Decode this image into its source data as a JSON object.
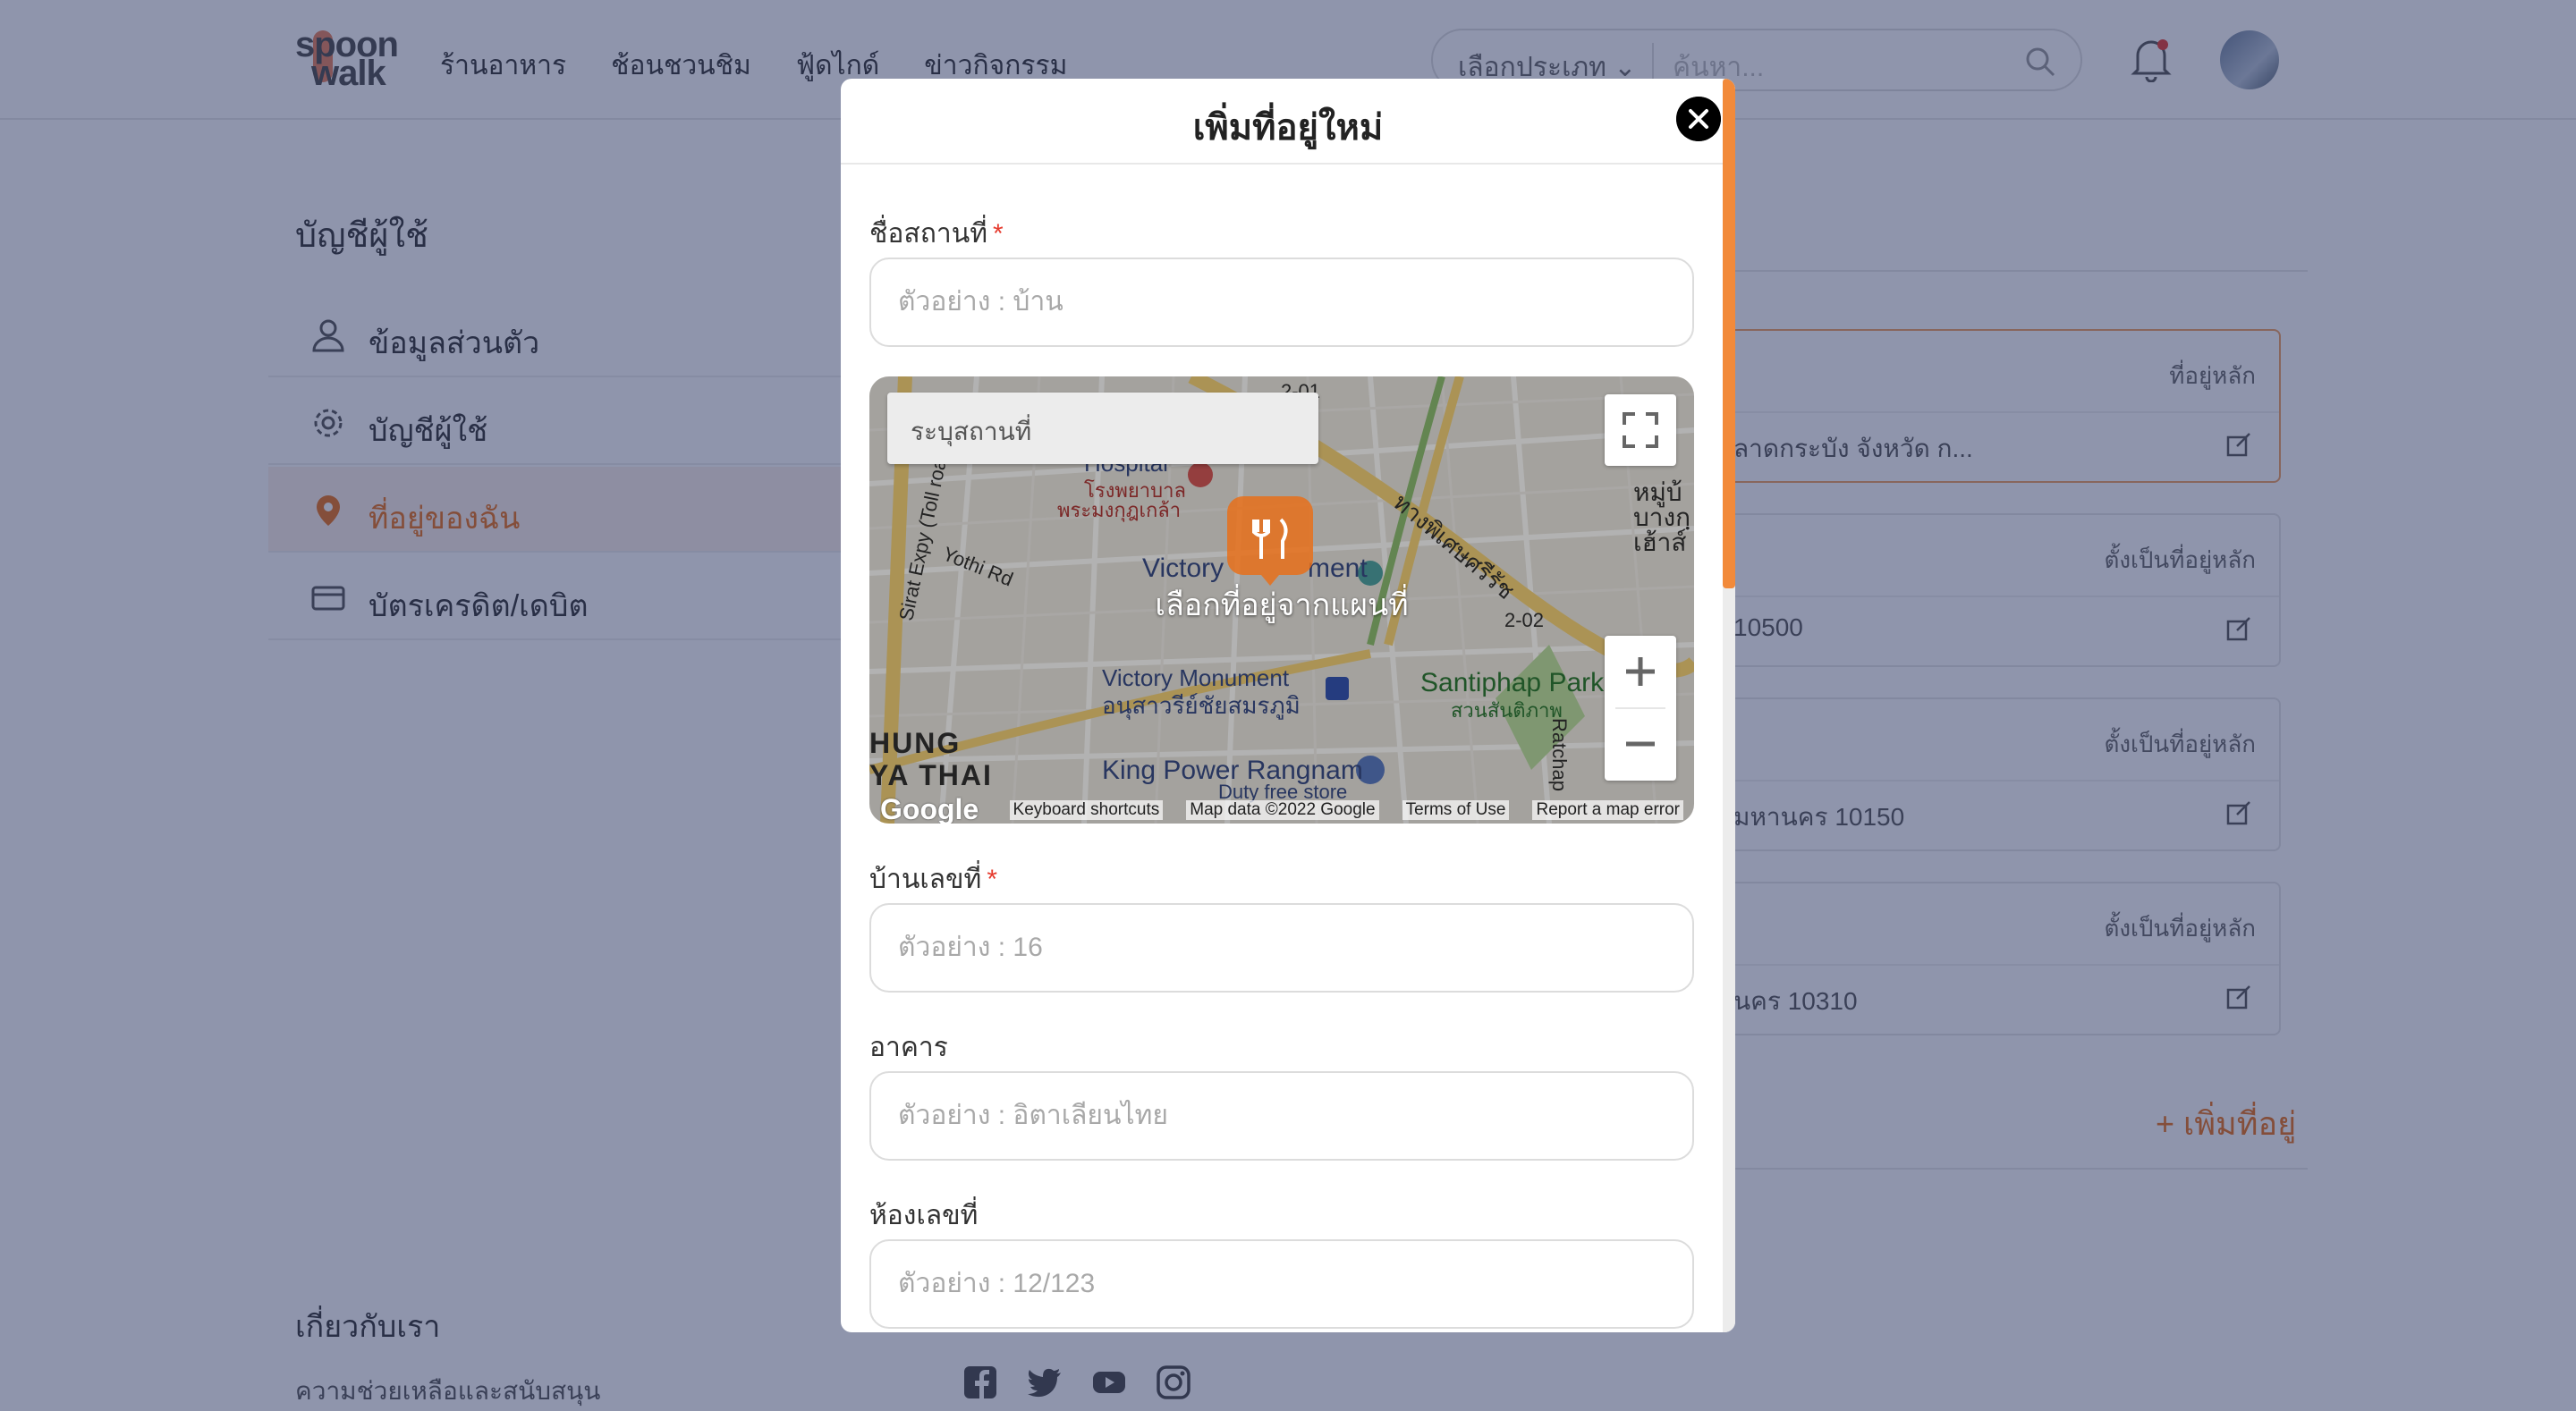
{
  "header": {
    "logo_top": "spoon",
    "logo_bottom": "walk",
    "nav": [
      "ร้านอาหาร",
      "ช้อนชวนชิม",
      "ฟู้ดไกด์",
      "ข่าวกิจกรรม"
    ],
    "category_select": "เลือกประเภท",
    "search_placeholder": "ค้นหา..."
  },
  "sidebar": {
    "title": "บัญชีผู้ใช้",
    "items": [
      {
        "label": "ข้อมูลส่วนตัว"
      },
      {
        "label": "บัญชีผู้ใช้"
      },
      {
        "label": "ที่อยู่ของฉัน"
      },
      {
        "label": "บัตรเครดิต/เดบิต"
      }
    ]
  },
  "addresses": [
    {
      "tag": "ที่อยู่หลัก",
      "text": "ลาดกระบัง จังหวัด ก..."
    },
    {
      "tag": "ตั้งเป็นที่อยู่หลัก",
      "text": "10500"
    },
    {
      "tag": "ตั้งเป็นที่อยู่หลัก",
      "text": "มหานคร 10150"
    },
    {
      "tag": "ตั้งเป็นที่อยู่หลัก",
      "text": "นคร 10310"
    }
  ],
  "add_address_label": "+ เพิ่มที่อยู่",
  "footer": {
    "title": "เกี่ยวกับเรา",
    "link": "ความช่วยเหลือและสนับสนุน"
  },
  "modal": {
    "title": "เพิ่มที่อยู่ใหม่",
    "fields": [
      {
        "label": "ชื่อสถานที่",
        "required": "*",
        "placeholder": "ตัวอย่าง : บ้าน"
      },
      {
        "label": "บ้านเลขที่",
        "required": "*",
        "placeholder": "ตัวอย่าง : 16"
      },
      {
        "label": "อาคาร",
        "placeholder": "ตัวอย่าง : อิตาเลียนไทย"
      },
      {
        "label": "ห้องเลขที่",
        "placeholder": "ตัวอย่าง : 12/123"
      }
    ],
    "map": {
      "search_placeholder": "ระบุสถานที่",
      "cta": "เลือกที่อยู่จากแผนที่",
      "places": {
        "hospital_th": "โรงพยาบาล",
        "hospital_th2": "พระมงกุฎเกล้า",
        "hospital_en": "Hospital",
        "monument_top": "Victory",
        "monument_top2": "ment",
        "monument": "Victory Monument",
        "monument_th": "อนุสาวรีย์ชัยสมรภูมิ",
        "park": "Santiphap Park",
        "park_th": "สวนสันติภาพ",
        "king_power": "King Power Rangnam",
        "duty_free": "Duty free store",
        "district1": "HUNG",
        "district2": "YA THAI",
        "village1": "หมู่บ้",
        "village2": "บางกฺ",
        "village3": "เฮ้าส์",
        "road_sirat": "Sirat Expy (Toll road)",
        "road_yothi": "Yothi Rd",
        "road_phiset": "ทางพิเศษศรีรัช",
        "road_202": "2-02",
        "road_201": "2-01",
        "road_ratchap": "Ratchap"
      },
      "google": "Google",
      "footer_links": [
        "Keyboard shortcuts",
        "Map data ©2022 Google",
        "Terms of Use",
        "Report a map error"
      ]
    }
  }
}
